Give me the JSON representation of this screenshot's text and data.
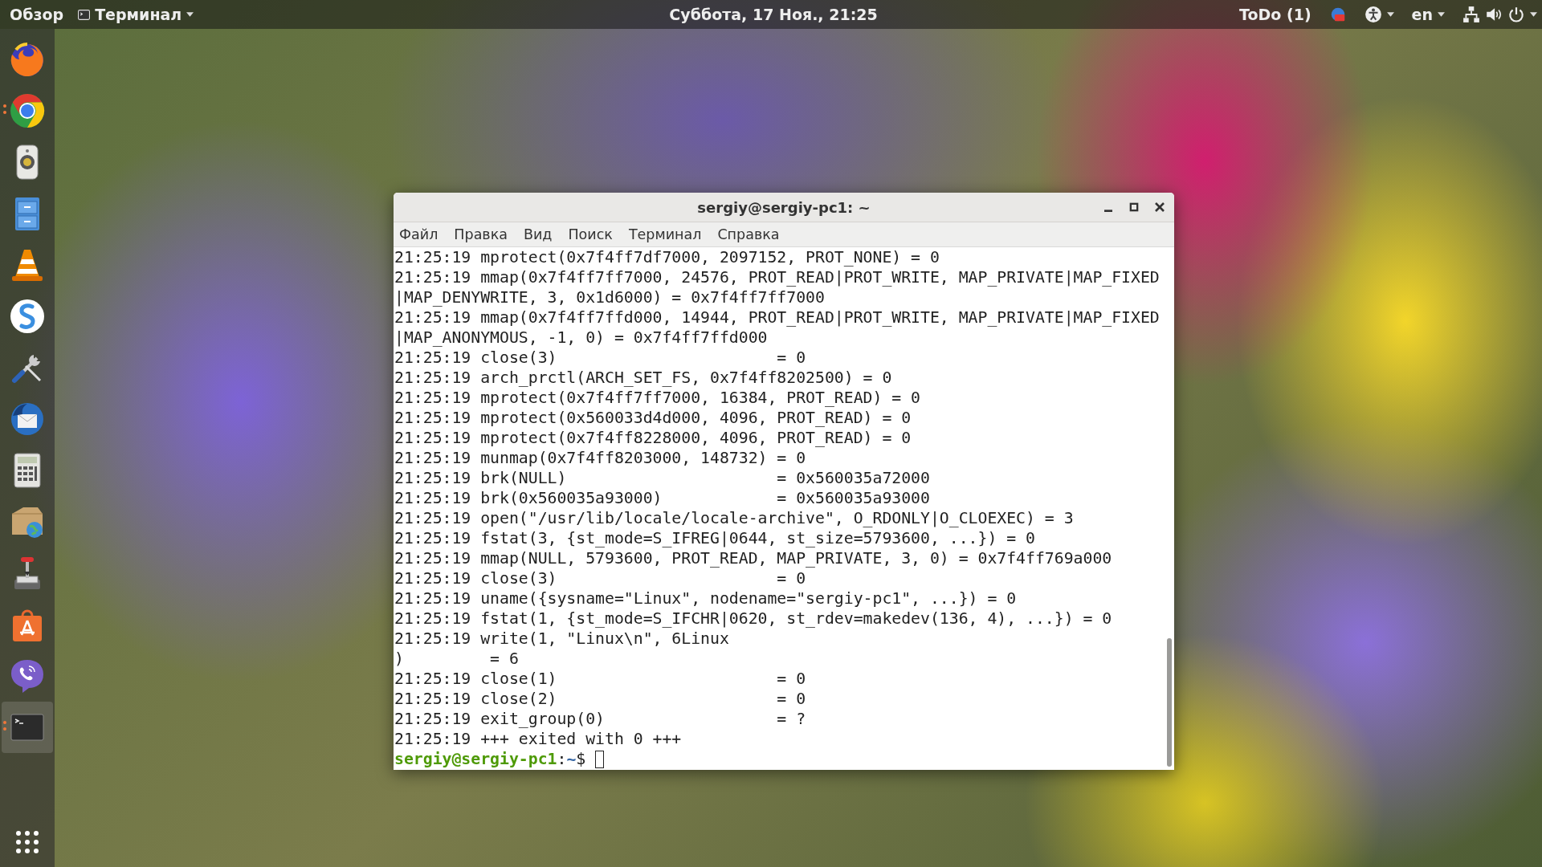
{
  "top_bar": {
    "activities": "Обзор",
    "app_menu": {
      "label": "Терминал"
    },
    "clock": "Суббота, 17 Ноя., 21:25",
    "todo": "ToDo (1)",
    "language": "en"
  },
  "dock": {
    "apps": [
      {
        "kind": "firefox",
        "running": false,
        "selected": false
      },
      {
        "kind": "chrome",
        "running": true,
        "selected": false
      },
      {
        "kind": "speaker",
        "running": false,
        "selected": false
      },
      {
        "kind": "files",
        "running": false,
        "selected": false
      },
      {
        "kind": "cone",
        "running": false,
        "selected": false
      },
      {
        "kind": "notes",
        "running": false,
        "selected": false
      },
      {
        "kind": "tools",
        "running": false,
        "selected": false
      },
      {
        "kind": "mail",
        "running": false,
        "selected": false
      },
      {
        "kind": "calculator",
        "running": false,
        "selected": false
      },
      {
        "kind": "package",
        "running": false,
        "selected": false
      },
      {
        "kind": "joystick",
        "running": false,
        "selected": false
      },
      {
        "kind": "store",
        "running": false,
        "selected": false
      },
      {
        "kind": "phone",
        "running": false,
        "selected": false
      },
      {
        "kind": "terminal",
        "running": true,
        "selected": true
      }
    ]
  },
  "terminal": {
    "title": "sergiy@sergiy-pc1: ~",
    "menu": [
      "Файл",
      "Правка",
      "Вид",
      "Поиск",
      "Терминал",
      "Справка"
    ],
    "lines": [
      "21:25:19 mprotect(0x7f4ff7df7000, 2097152, PROT_NONE) = 0",
      "21:25:19 mmap(0x7f4ff7ff7000, 24576, PROT_READ|PROT_WRITE, MAP_PRIVATE|MAP_FIXED",
      "|MAP_DENYWRITE, 3, 0x1d6000) = 0x7f4ff7ff7000",
      "21:25:19 mmap(0x7f4ff7ffd000, 14944, PROT_READ|PROT_WRITE, MAP_PRIVATE|MAP_FIXED",
      "|MAP_ANONYMOUS, -1, 0) = 0x7f4ff7ffd000",
      "21:25:19 close(3)                       = 0",
      "21:25:19 arch_prctl(ARCH_SET_FS, 0x7f4ff8202500) = 0",
      "21:25:19 mprotect(0x7f4ff7ff7000, 16384, PROT_READ) = 0",
      "21:25:19 mprotect(0x560033d4d000, 4096, PROT_READ) = 0",
      "21:25:19 mprotect(0x7f4ff8228000, 4096, PROT_READ) = 0",
      "21:25:19 munmap(0x7f4ff8203000, 148732) = 0",
      "21:25:19 brk(NULL)                      = 0x560035a72000",
      "21:25:19 brk(0x560035a93000)            = 0x560035a93000",
      "21:25:19 open(\"/usr/lib/locale/locale-archive\", O_RDONLY|O_CLOEXEC) = 3",
      "21:25:19 fstat(3, {st_mode=S_IFREG|0644, st_size=5793600, ...}) = 0",
      "21:25:19 mmap(NULL, 5793600, PROT_READ, MAP_PRIVATE, 3, 0) = 0x7f4ff769a000",
      "21:25:19 close(3)                       = 0",
      "21:25:19 uname({sysname=\"Linux\", nodename=\"sergiy-pc1\", ...}) = 0",
      "21:25:19 fstat(1, {st_mode=S_IFCHR|0620, st_rdev=makedev(136, 4), ...}) = 0",
      "21:25:19 write(1, \"Linux\\n\", 6Linux",
      ")         = 6",
      "21:25:19 close(1)                       = 0",
      "21:25:19 close(2)                       = 0",
      "21:25:19 exit_group(0)                  = ?",
      "21:25:19 +++ exited with 0 +++"
    ],
    "prompt": {
      "user_host": "sergiy@sergiy-pc1",
      "separator": ":",
      "path": "~",
      "symbol": "$"
    }
  }
}
